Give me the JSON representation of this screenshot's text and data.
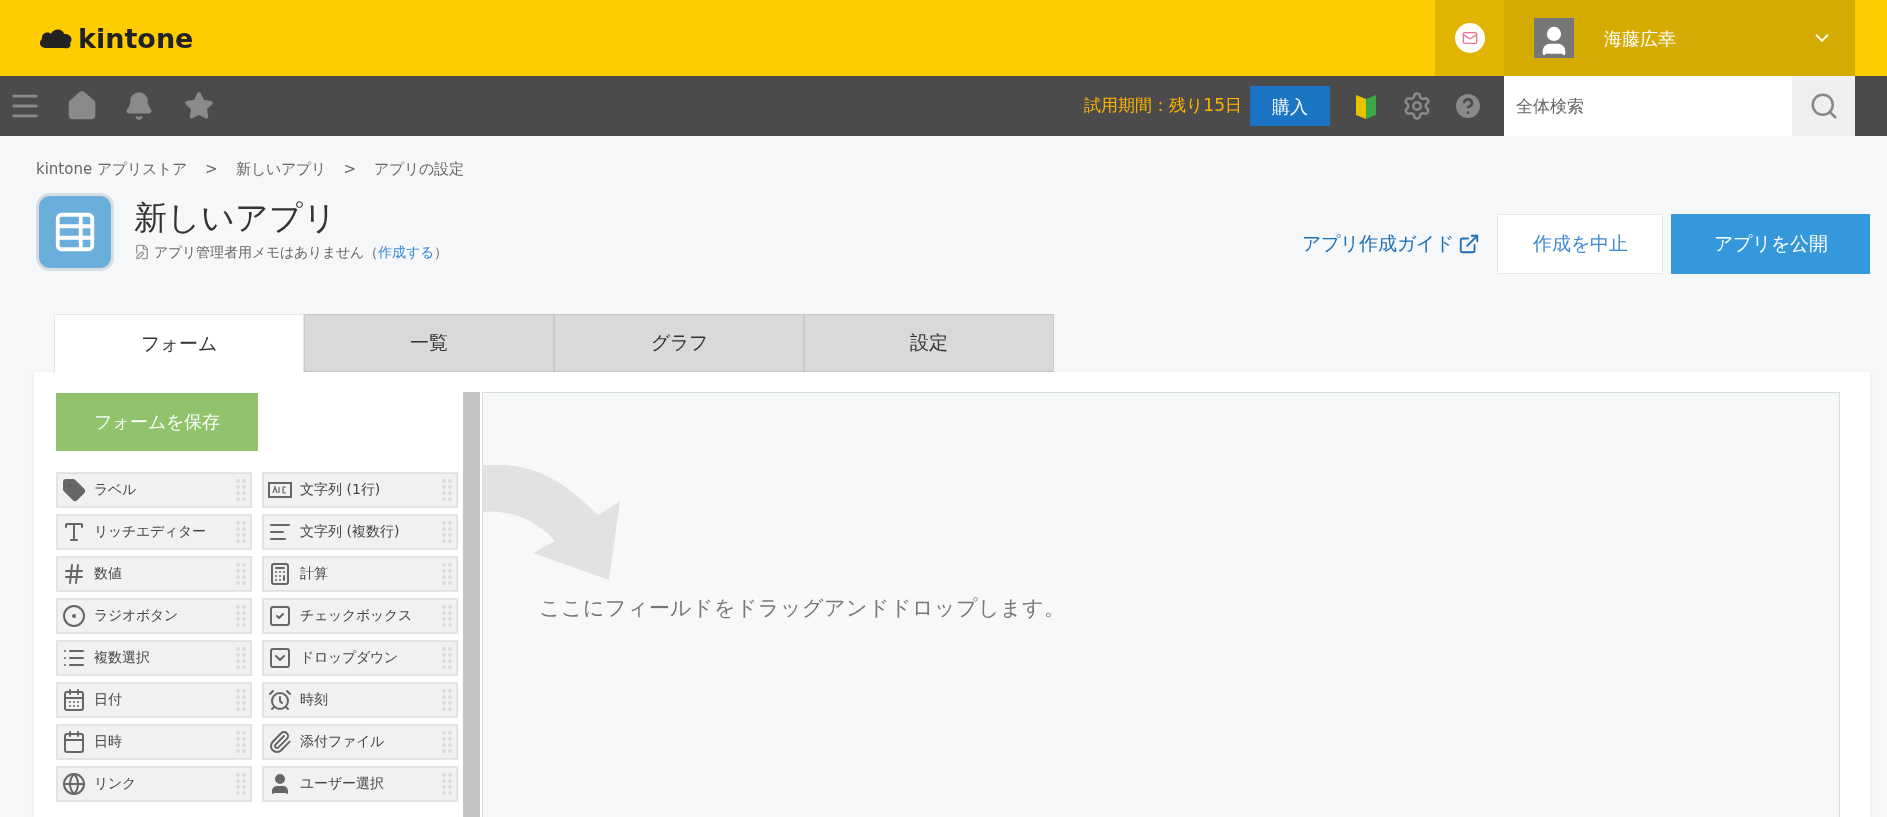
{
  "header": {
    "logo": "kintone",
    "user_name": "海藤広幸"
  },
  "toolbar": {
    "trial": "試用期間：残り15日",
    "buy": "購入",
    "search": {
      "placeholder": "全体検索"
    }
  },
  "breadcrumb": {
    "items": [
      "kintone アプリストア",
      "新しいアプリ",
      "アプリの設定"
    ],
    "separator": ">"
  },
  "app": {
    "title": "新しいアプリ",
    "memo": "アプリ管理者用メモはありません（",
    "memo_link": "作成する",
    "memo_end": "）",
    "guide": "アプリ作成ガイド",
    "cancel": "作成を中止",
    "publish": "アプリを公開"
  },
  "tabs": [
    {
      "label": "フォーム",
      "selected": true
    },
    {
      "label": "一覧",
      "selected": false
    },
    {
      "label": "グラフ",
      "selected": false
    },
    {
      "label": "設定",
      "selected": false
    }
  ],
  "palette": {
    "save": "フォームを保存",
    "fields": [
      "ラベル",
      "文字列 (1行)",
      "リッチエディター",
      "文字列 (複数行)",
      "数値",
      "計算",
      "ラジオボタン",
      "チェックボックス",
      "複数選択",
      "ドロップダウン",
      "日付",
      "時刻",
      "日時",
      "添付ファイル",
      "リンク",
      "ユーザー選択"
    ]
  },
  "canvas": {
    "hint": "ここにフィールドをドラッグアンドドロップします。"
  }
}
